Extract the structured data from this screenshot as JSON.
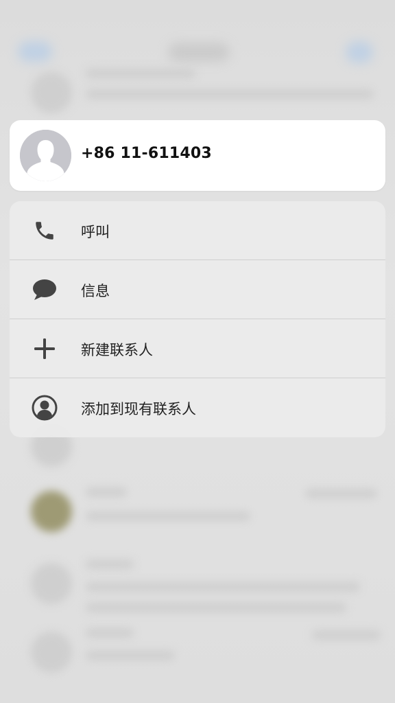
{
  "contact": {
    "number": "+86 11-611403",
    "avatar_icon": "person-silhouette-icon"
  },
  "menu": {
    "items": [
      {
        "label": "呼叫",
        "icon": "phone-icon"
      },
      {
        "label": "信息",
        "icon": "message-bubble-icon"
      },
      {
        "label": "新建联系人",
        "icon": "plus-icon"
      },
      {
        "label": "添加到现有联系人",
        "icon": "person-circle-icon"
      }
    ]
  },
  "colors": {
    "card_bg": "#ffffff",
    "menu_bg": "#ebebeb",
    "icon": "#444444",
    "text": "#222222"
  }
}
